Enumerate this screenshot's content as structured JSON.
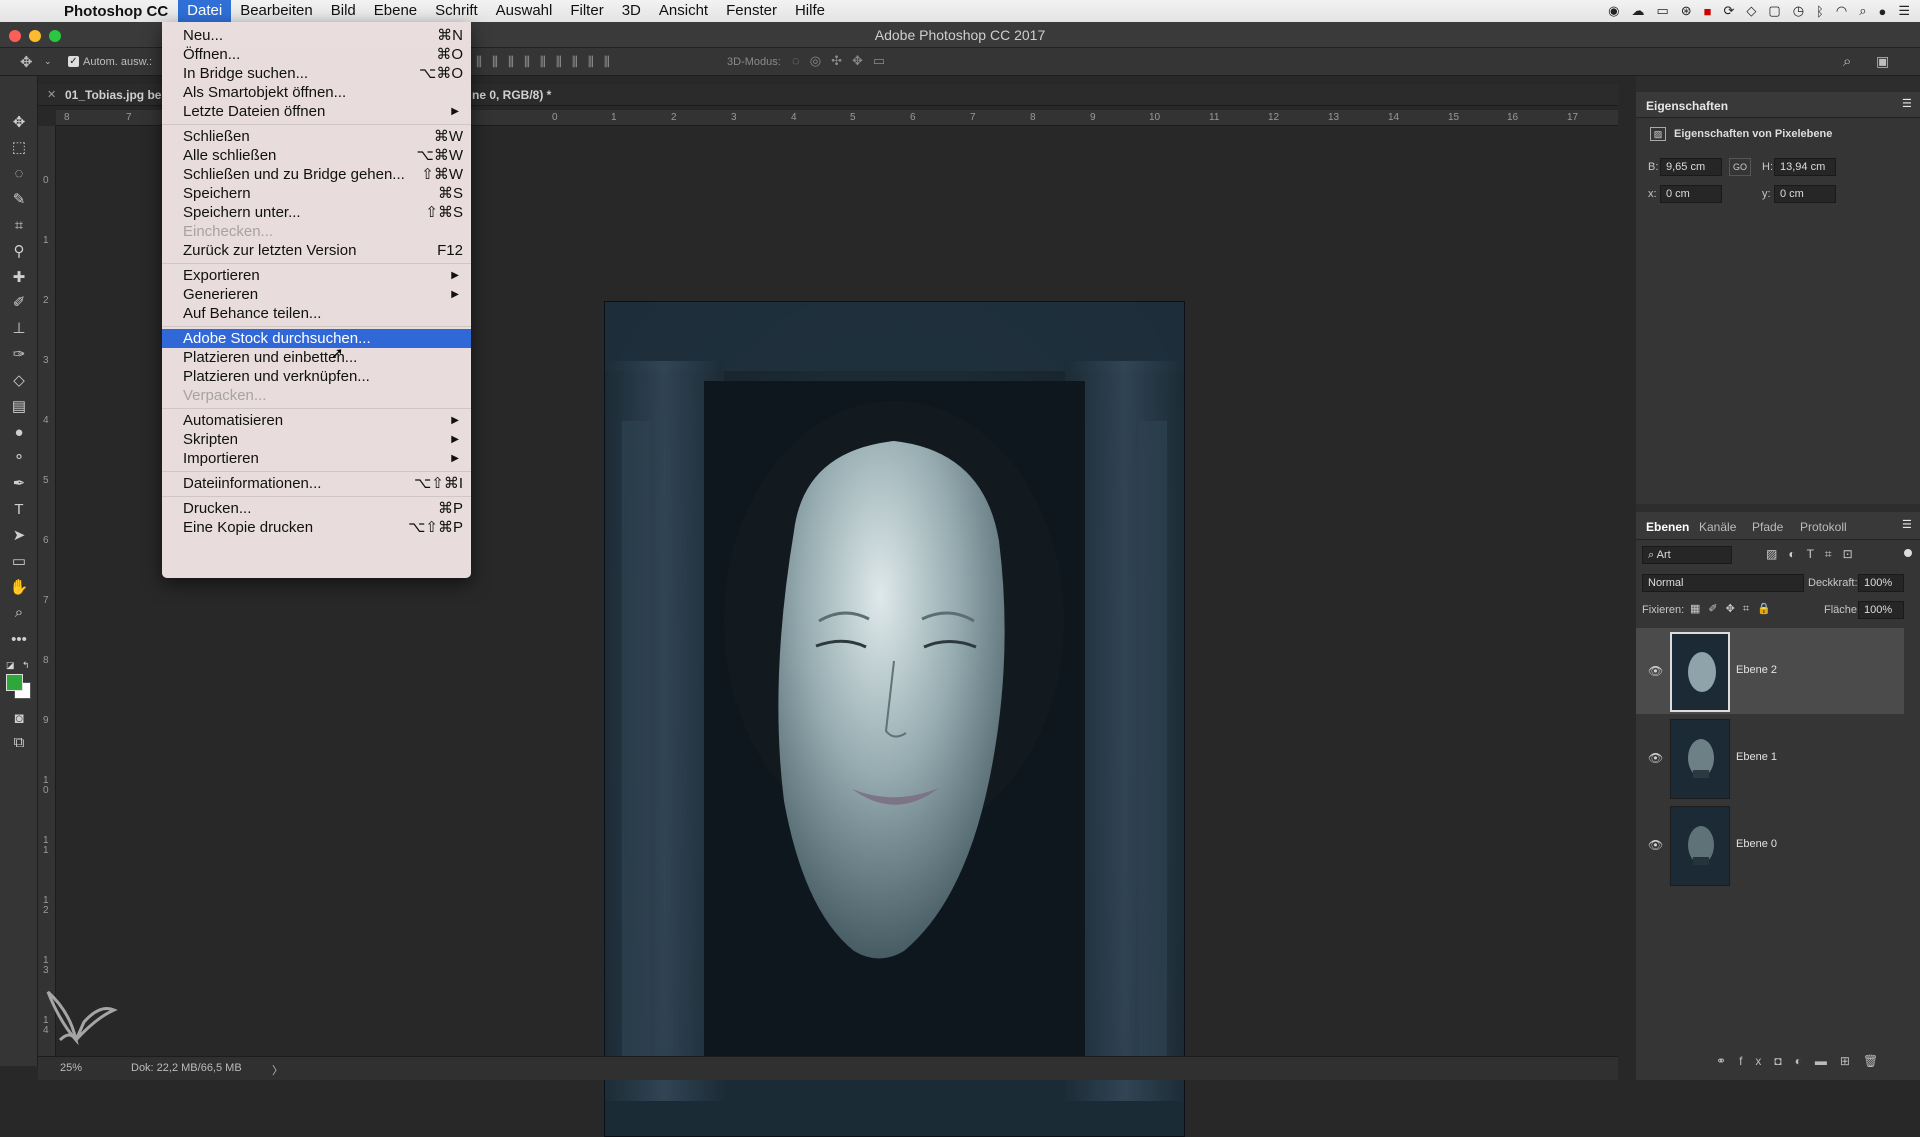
{
  "menubar": {
    "app_name": "Photoshop CC",
    "items": [
      "Datei",
      "Bearbeiten",
      "Bild",
      "Ebene",
      "Schrift",
      "Auswahl",
      "Filter",
      "3D",
      "Ansicht",
      "Fenster",
      "Hilfe"
    ],
    "active": "Datei"
  },
  "window": {
    "title": "Adobe Photoshop CC 2017"
  },
  "options_bar": {
    "auto_select_label": "Autom. ausw.:",
    "mode_3d_label": "3D-Modus:"
  },
  "document": {
    "tab_name": "01_Tobias.jpg be",
    "tab_suffix": "ne 0, RGB/8) *"
  },
  "rulers": {
    "h_ticks": [
      "8",
      "7",
      "0",
      "1",
      "2",
      "3",
      "4",
      "5",
      "6",
      "7",
      "8",
      "9",
      "10",
      "11",
      "12",
      "13",
      "14",
      "15",
      "16",
      "17"
    ],
    "v_ticks": [
      "0",
      "1",
      "2",
      "3",
      "4",
      "5",
      "6",
      "7",
      "8",
      "9",
      "1 0",
      "1 1",
      "1 2",
      "1 3",
      "1 4"
    ]
  },
  "status": {
    "zoom": "25%",
    "doc_size": "Dok: 22,2 MB/66,5 MB",
    "arrow": "〉"
  },
  "file_menu": {
    "groups": [
      [
        {
          "label": "Neu...",
          "shortcut": "⌘N"
        },
        {
          "label": "Öffnen...",
          "shortcut": "⌘O"
        },
        {
          "label": "In Bridge suchen...",
          "shortcut": "⌥⌘O"
        },
        {
          "label": "Als Smartobjekt öffnen...",
          "shortcut": ""
        },
        {
          "label": "Letzte Dateien öffnen",
          "shortcut": "",
          "submenu": true
        }
      ],
      [
        {
          "label": "Schließen",
          "shortcut": "⌘W"
        },
        {
          "label": "Alle schließen",
          "shortcut": "⌥⌘W"
        },
        {
          "label": "Schließen und zu Bridge gehen...",
          "shortcut": "⇧⌘W"
        },
        {
          "label": "Speichern",
          "shortcut": "⌘S"
        },
        {
          "label": "Speichern unter...",
          "shortcut": "⇧⌘S"
        },
        {
          "label": "Einchecken...",
          "shortcut": "",
          "disabled": true
        },
        {
          "label": "Zurück zur letzten Version",
          "shortcut": "F12"
        }
      ],
      [
        {
          "label": "Exportieren",
          "shortcut": "",
          "submenu": true
        },
        {
          "label": "Generieren",
          "shortcut": "",
          "submenu": true
        },
        {
          "label": "Auf Behance teilen...",
          "shortcut": ""
        }
      ],
      [
        {
          "label": "Adobe Stock durchsuchen...",
          "shortcut": "",
          "highlighted": true
        },
        {
          "label": "Platzieren und einbetten...",
          "shortcut": ""
        },
        {
          "label": "Platzieren und verknüpfen...",
          "shortcut": ""
        },
        {
          "label": "Verpacken...",
          "shortcut": "",
          "disabled": true
        }
      ],
      [
        {
          "label": "Automatisieren",
          "shortcut": "",
          "submenu": true
        },
        {
          "label": "Skripten",
          "shortcut": "",
          "submenu": true
        },
        {
          "label": "Importieren",
          "shortcut": "",
          "submenu": true
        }
      ],
      [
        {
          "label": "Dateiinformationen...",
          "shortcut": "⌥⇧⌘I"
        }
      ],
      [
        {
          "label": "Drucken...",
          "shortcut": "⌘P"
        },
        {
          "label": "Eine Kopie drucken",
          "shortcut": "⌥⇧⌘P"
        }
      ]
    ]
  },
  "properties": {
    "panel_title": "Eigenschaften",
    "subtitle": "Eigenschaften von Pixelebene",
    "w_label": "B:",
    "w_value": "9,65 cm",
    "h_label": "H:",
    "h_value": "13,94 cm",
    "x_label": "x:",
    "x_value": "0 cm",
    "y_label": "y:",
    "y_value": "0 cm",
    "link_label": "GO"
  },
  "layers": {
    "tabs": [
      "Ebenen",
      "Kanäle",
      "Pfade",
      "Protokoll"
    ],
    "filter": "Art",
    "blend_mode": "Normal",
    "opacity_label": "Deckkraft:",
    "opacity": "100%",
    "lock_label": "Fixieren:",
    "fill_label": "Fläche:",
    "fill": "100%",
    "items": [
      {
        "name": "Ebene 2",
        "selected": true
      },
      {
        "name": "Ebene 1",
        "selected": false
      },
      {
        "name": "Ebene 0",
        "selected": false
      }
    ]
  },
  "colors": {
    "foreground": "#2ea83a",
    "background": "#ffffff",
    "menu_highlight": "#3168d8"
  }
}
